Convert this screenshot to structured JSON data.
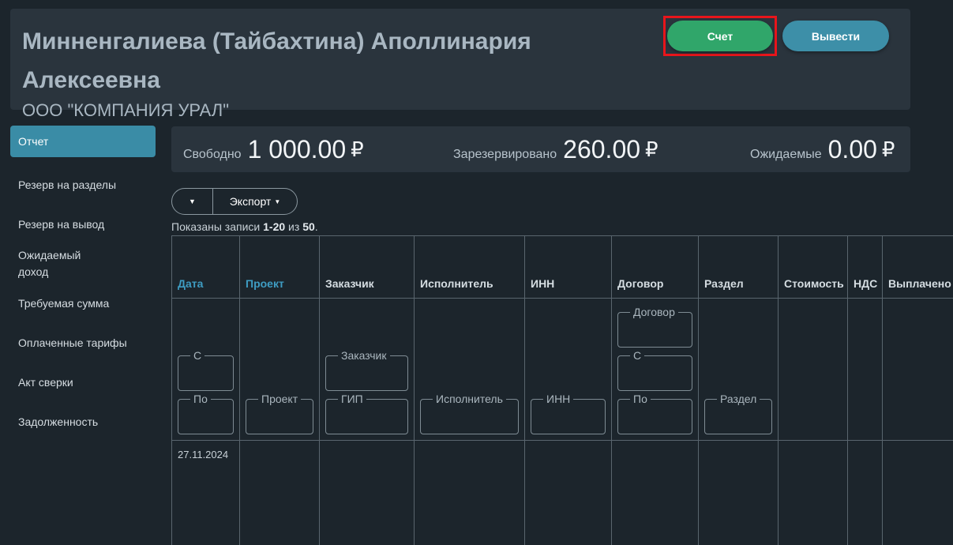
{
  "header": {
    "user_name": "Минненгалиева (Тайбахтина) Аполлинария Алексеевна",
    "company": "ООО \"КОМПАНИЯ УРАЛ\"",
    "invoice_label": "Счет",
    "withdraw_label": "Вывести"
  },
  "sidebar": {
    "items": [
      {
        "label": "Отчет",
        "active": true
      },
      {
        "label": "Резерв на разделы"
      },
      {
        "label": "Резерв на вывод"
      },
      {
        "label": "Ожидаемый доход"
      },
      {
        "label": "Требуемая сумма"
      },
      {
        "label": "Оплаченные тарифы"
      },
      {
        "label": "Акт сверки"
      },
      {
        "label": "Задолженность"
      }
    ]
  },
  "balances": {
    "free": {
      "label": "Свободно",
      "value": "1 000.00",
      "currency": "₽"
    },
    "reserved": {
      "label": "Зарезервировано",
      "value": "260.00",
      "currency": "₽"
    },
    "expected": {
      "label": "Ожидаемые",
      "value": "0.00",
      "currency": "₽"
    }
  },
  "toolbar": {
    "caret": "▼",
    "export_label": "Экспорт",
    "export_caret": "▼"
  },
  "summary": {
    "prefix": "Показаны записи ",
    "range": "1-20",
    "middle": " из ",
    "total": "50",
    "suffix": "."
  },
  "table": {
    "columns": [
      "Дата",
      "Проект",
      "Заказчик",
      "Исполнитель",
      "ИНН",
      "Договор",
      "Раздел",
      "Стоимость",
      "НДС",
      "Выплачено"
    ],
    "filters": {
      "date_from": "С",
      "date_to": "По",
      "project": "Проект",
      "customer": "Заказчик",
      "gip": "ГИП",
      "contractor": "Исполнитель",
      "inn": "ИНН",
      "contract": "Договор",
      "contract_from": "С",
      "contract_to": "По",
      "section": "Раздел"
    },
    "rows": [
      {
        "date": "27.11.2024"
      }
    ]
  }
}
